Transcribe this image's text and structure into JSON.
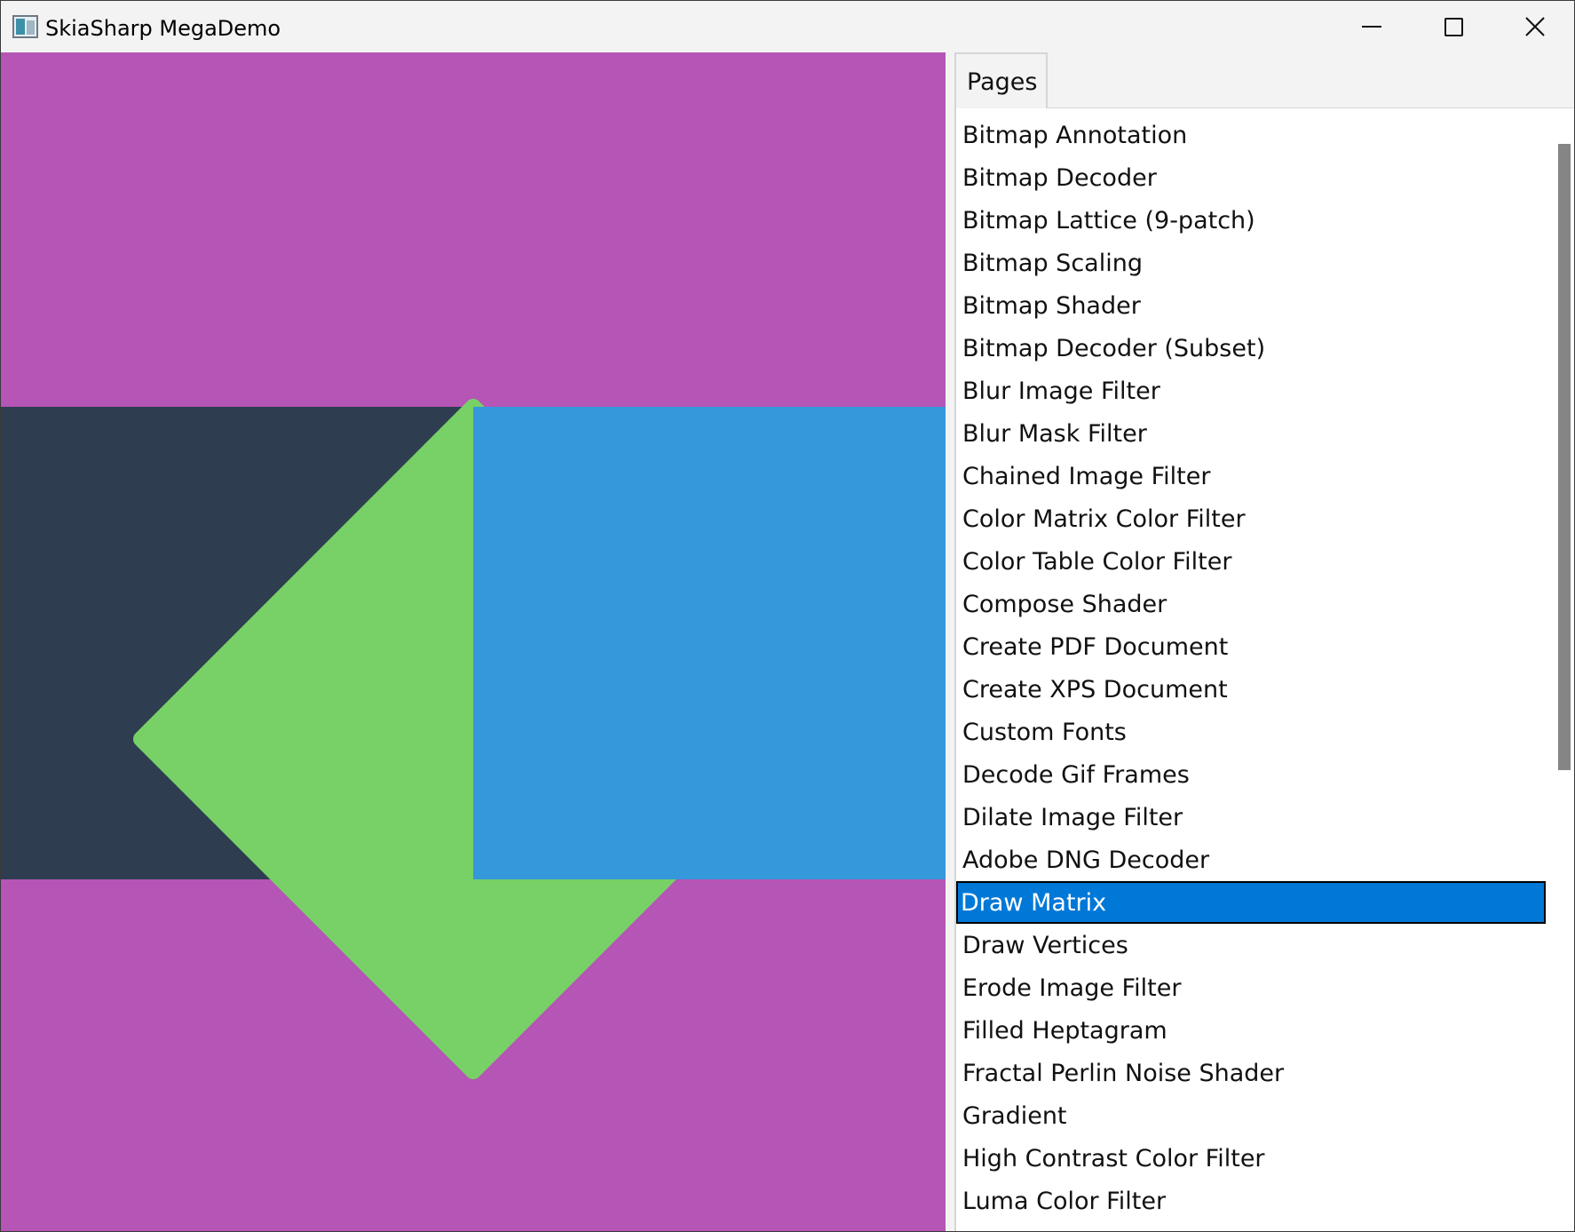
{
  "window": {
    "title": "SkiaSharp MegaDemo",
    "icon": "app-icon"
  },
  "caption_buttons": {
    "minimize_icon": "minimize-icon",
    "maximize_icon": "maximize-icon",
    "close_icon": "close-icon"
  },
  "canvas": {
    "background_color": "#b555b5",
    "dark_band_color": "#2e3e50",
    "blue_square_color": "#3598db",
    "diamond_color": "#77d166"
  },
  "pages_panel": {
    "tab_label": "Pages",
    "selected_color": "#0078d7",
    "selected_index": 18,
    "items": [
      "Bitmap Annotation",
      "Bitmap Decoder",
      "Bitmap Lattice (9-patch)",
      "Bitmap Scaling",
      "Bitmap Shader",
      "Bitmap Decoder (Subset)",
      "Blur Image Filter",
      "Blur Mask Filter",
      "Chained Image Filter",
      "Color Matrix Color Filter",
      "Color Table Color Filter",
      "Compose Shader",
      "Create PDF Document",
      "Create XPS Document",
      "Custom Fonts",
      "Decode Gif Frames",
      "Dilate Image Filter",
      "Adobe DNG Decoder",
      "Draw Matrix",
      "Draw Vertices",
      "Erode Image Filter",
      "Filled Heptagram",
      "Fractal Perlin Noise Shader",
      "Gradient",
      "High Contrast Color Filter",
      "Luma Color Filter"
    ]
  }
}
